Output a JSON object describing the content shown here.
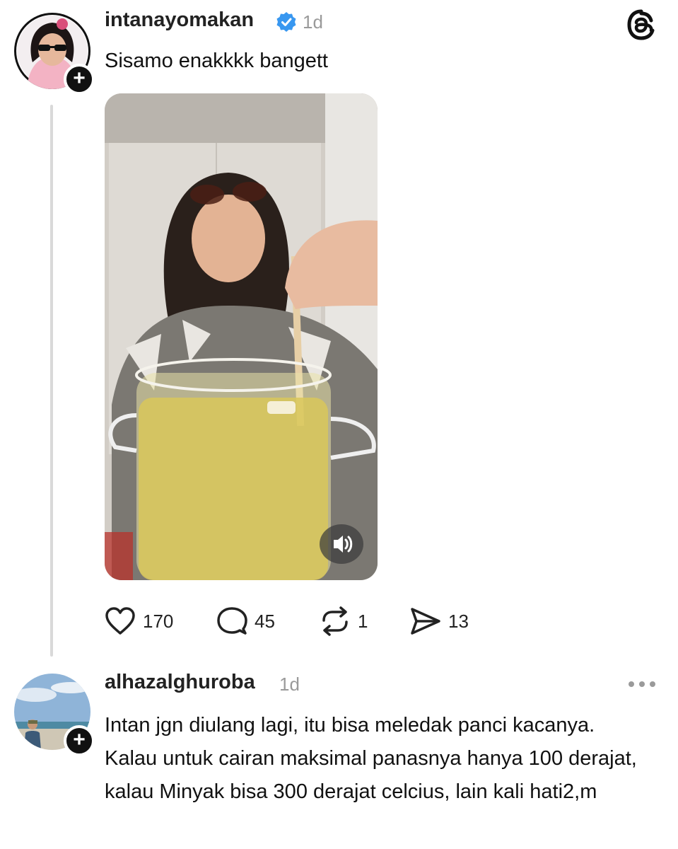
{
  "post": {
    "username": "intanayomakan",
    "verified": true,
    "time": "1d",
    "text": "Sisamo enakkkk bangett",
    "video_muted_icon": "speaker-icon",
    "actions": {
      "likes": "170",
      "replies": "45",
      "reposts": "1",
      "shares": "13"
    }
  },
  "reply": {
    "username": "alhazalghuroba",
    "time": "1d",
    "text": "Intan jgn diulang lagi, itu bisa meledak panci kacanya. Kalau untuk cairan maksimal panasnya hanya 100 derajat, kalau Minyak bisa 300 derajat celcius, lain kali hati2,m"
  },
  "icons": {
    "app_logo": "threads-logo-icon",
    "more": "more-dots-icon",
    "follow": "plus-icon",
    "verified": "verified-badge-icon"
  },
  "colors": {
    "verified": "#3897f0",
    "muted_text": "#9a9a9a",
    "thread_line": "#d9d9d9"
  }
}
